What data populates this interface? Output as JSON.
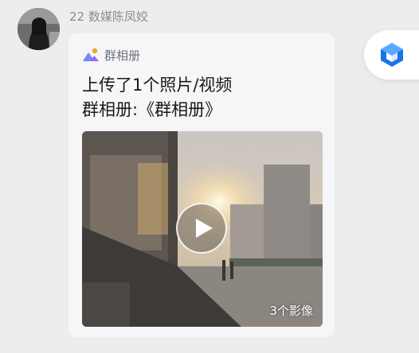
{
  "sender": {
    "name": "22 数媒陈凤姣"
  },
  "card": {
    "album_label": "群相册",
    "line1": "上传了1个照片/视频",
    "line2": "群相册:《群相册》",
    "media_count": "3个影像"
  },
  "icons": {
    "album": "album-mountain-icon",
    "play": "play-icon",
    "floating": "cube-app-icon"
  },
  "colors": {
    "background": "#ededed",
    "card": "#f6f6f8",
    "accent_blue": "#1a73e8",
    "accent_orange": "#f5a623",
    "accent_purple": "#8e6cf0"
  }
}
